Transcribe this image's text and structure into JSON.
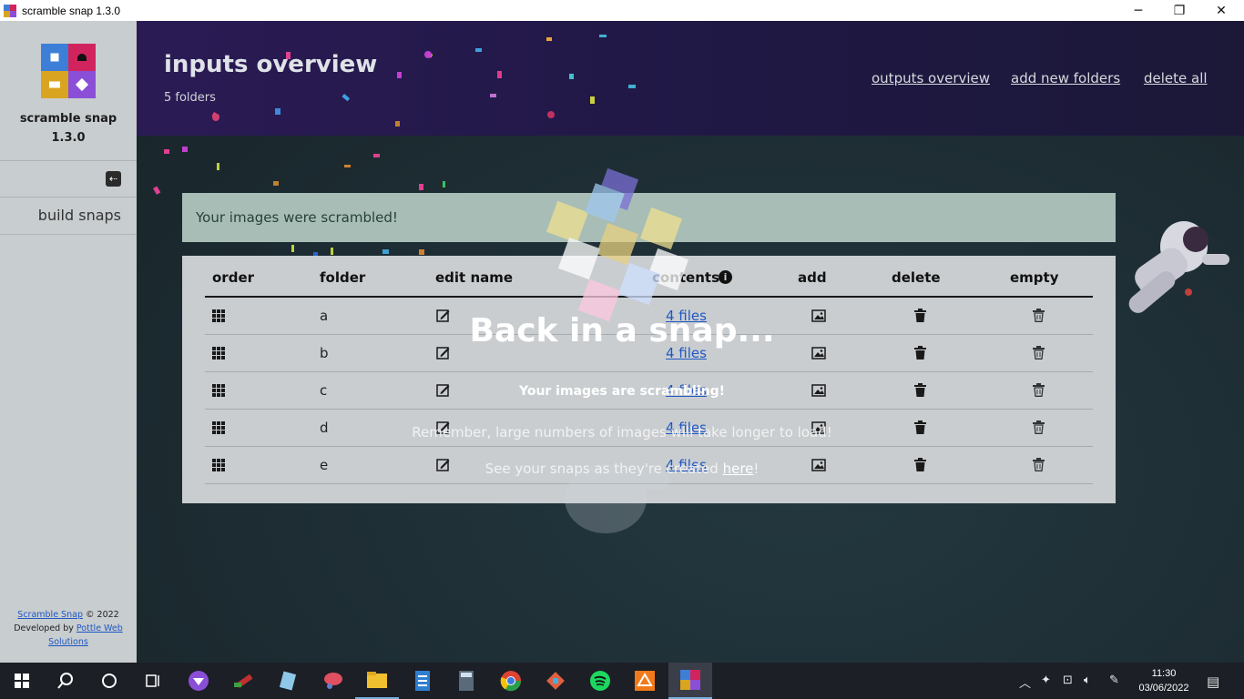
{
  "window": {
    "title": "scramble snap 1.3.0",
    "minimize": "─",
    "maximize": "❐",
    "close": "✕"
  },
  "sidebar": {
    "app_name": "scramble snap",
    "version": "1.3.0",
    "collapse_glyph": "⇠",
    "build_link": "build snaps",
    "footer": {
      "brand": "Scramble Snap",
      "copyright": " © 2022",
      "developed_by": "Developed by ",
      "developer": "Pottle Web Solutions"
    }
  },
  "header": {
    "title": "inputs overview",
    "subtitle": "5 folders",
    "nav": [
      "outputs overview",
      "add new folders",
      "delete all"
    ]
  },
  "alert": {
    "text": "Your images were scrambled!"
  },
  "table": {
    "columns": [
      "order",
      "folder",
      "edit name",
      "contents",
      "add",
      "delete",
      "empty"
    ],
    "info_glyph": "i",
    "rows": [
      {
        "folder": "a",
        "contents": "4 files"
      },
      {
        "folder": "b",
        "contents": "4 files"
      },
      {
        "folder": "c",
        "contents": "4 files"
      },
      {
        "folder": "d",
        "contents": "4 files"
      },
      {
        "folder": "e",
        "contents": "4 files"
      }
    ]
  },
  "overlay": {
    "title": "Back in a snap...",
    "subtitle": "Your images are scrambling!",
    "note": "Remember, large numbers of images will take longer to load!",
    "link_prefix": "See your snaps as they're created ",
    "link_text": "here",
    "link_suffix": "!"
  },
  "taskbar": {
    "time": "11:30",
    "date": "03/06/2022",
    "apps": [
      "start-icon",
      "search-icon",
      "cortana-icon",
      "task-view-icon",
      "app-icon",
      "paint-icon",
      "notepad-icon",
      "snip-icon",
      "file-explorer-icon",
      "document-icon",
      "calculator-icon",
      "chrome-icon",
      "git-icon",
      "spotify-icon",
      "tool-icon",
      "scramble-snap-icon"
    ]
  },
  "colors": {
    "header_bg": "#201845",
    "alert_bg": "#a7bdb6",
    "link": "#1f57c4",
    "sidebar_bg": "#c8cdcf"
  }
}
